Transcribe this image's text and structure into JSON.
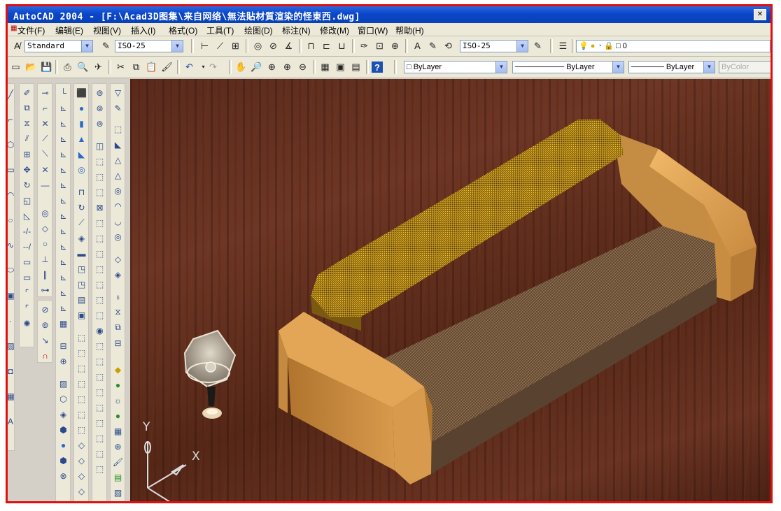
{
  "window": {
    "title": "AutoCAD 2004 - [F:\\Acad3D图集\\来自网络\\無法貼材質渲染的怪東西.dwg]",
    "close_glyph": "✕"
  },
  "menu": [
    {
      "label": "文件(F)"
    },
    {
      "label": "编辑(E)"
    },
    {
      "label": "视图(V)"
    },
    {
      "label": "插入(I)"
    },
    {
      "label": "格式(O)"
    },
    {
      "label": "工具(T)"
    },
    {
      "label": "绘图(D)"
    },
    {
      "label": "标注(N)"
    },
    {
      "label": "修改(M)"
    },
    {
      "label": "窗口(W)"
    },
    {
      "label": "帮助(H)"
    }
  ],
  "styles_toolbar": {
    "text_style": "Standard",
    "dim_style": "ISO-25",
    "dim_style2": "ISO-25",
    "layer": "0"
  },
  "properties_toolbar": {
    "color": "ByLayer",
    "linetype": "ByLayer",
    "lineweight": "ByLayer",
    "plot_style": "ByColor"
  },
  "ucs": {
    "y_label": "Y",
    "x_label": "X"
  },
  "colors": {
    "title_bar": "#0a46c8",
    "sofa_frame": "#d39a4c",
    "sofa_cushion": "#b38a22",
    "floor": "#5e2b1b",
    "frame_border": "#e01010"
  }
}
